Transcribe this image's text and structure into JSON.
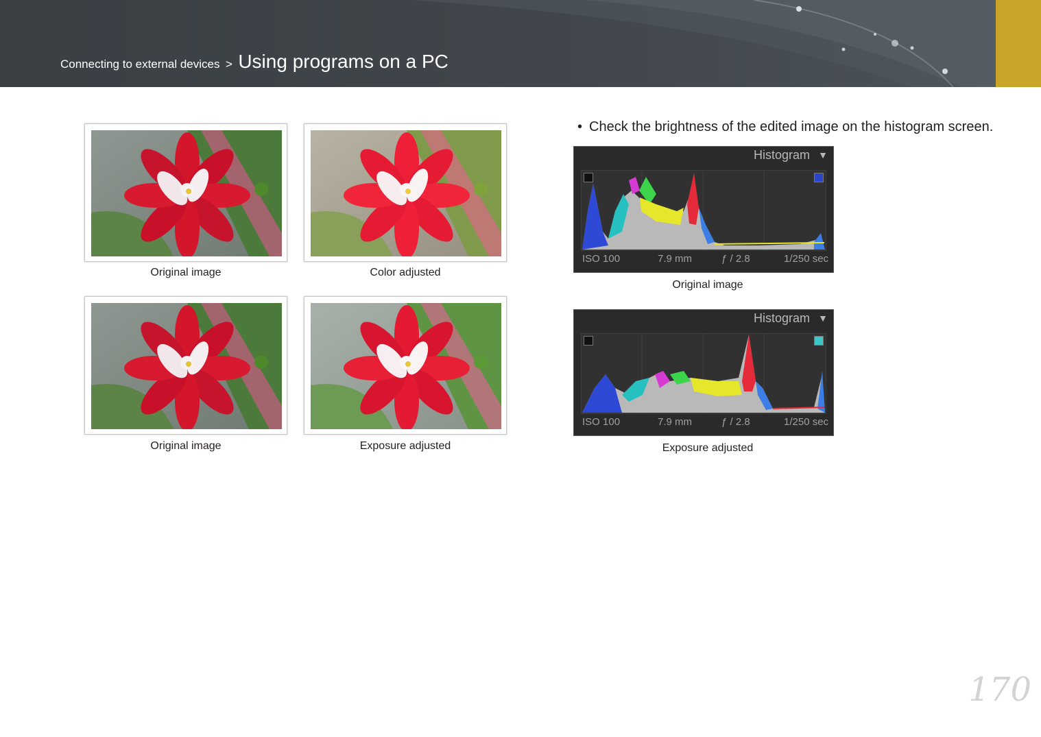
{
  "header": {
    "breadcrumb": "Connecting to external devices",
    "separator": ">",
    "title": "Using programs on a PC",
    "accent_color": "#c9a627"
  },
  "photos": [
    {
      "caption": "Original image",
      "variant": "original"
    },
    {
      "caption": "Color adjusted",
      "variant": "color-adjusted"
    },
    {
      "caption": "Original image",
      "variant": "original"
    },
    {
      "caption": "Exposure adjusted",
      "variant": "exposure-adjusted"
    }
  ],
  "bullet": {
    "symbol": "•",
    "text": "Check the brightness of the edited image on the histogram screen."
  },
  "histograms": [
    {
      "panel_title": "Histogram",
      "iso": "ISO 100",
      "focal": "7.9 mm",
      "aperture": "ƒ / 2.8",
      "shutter": "1/250 sec",
      "caption": "Original image",
      "clip_color": "#2b45c8"
    },
    {
      "panel_title": "Histogram",
      "iso": "ISO 100",
      "focal": "7.9 mm",
      "aperture": "ƒ / 2.8",
      "shutter": "1/250 sec",
      "caption": "Exposure adjusted",
      "clip_color": "#3ec6c6"
    }
  ],
  "page_number": "170"
}
